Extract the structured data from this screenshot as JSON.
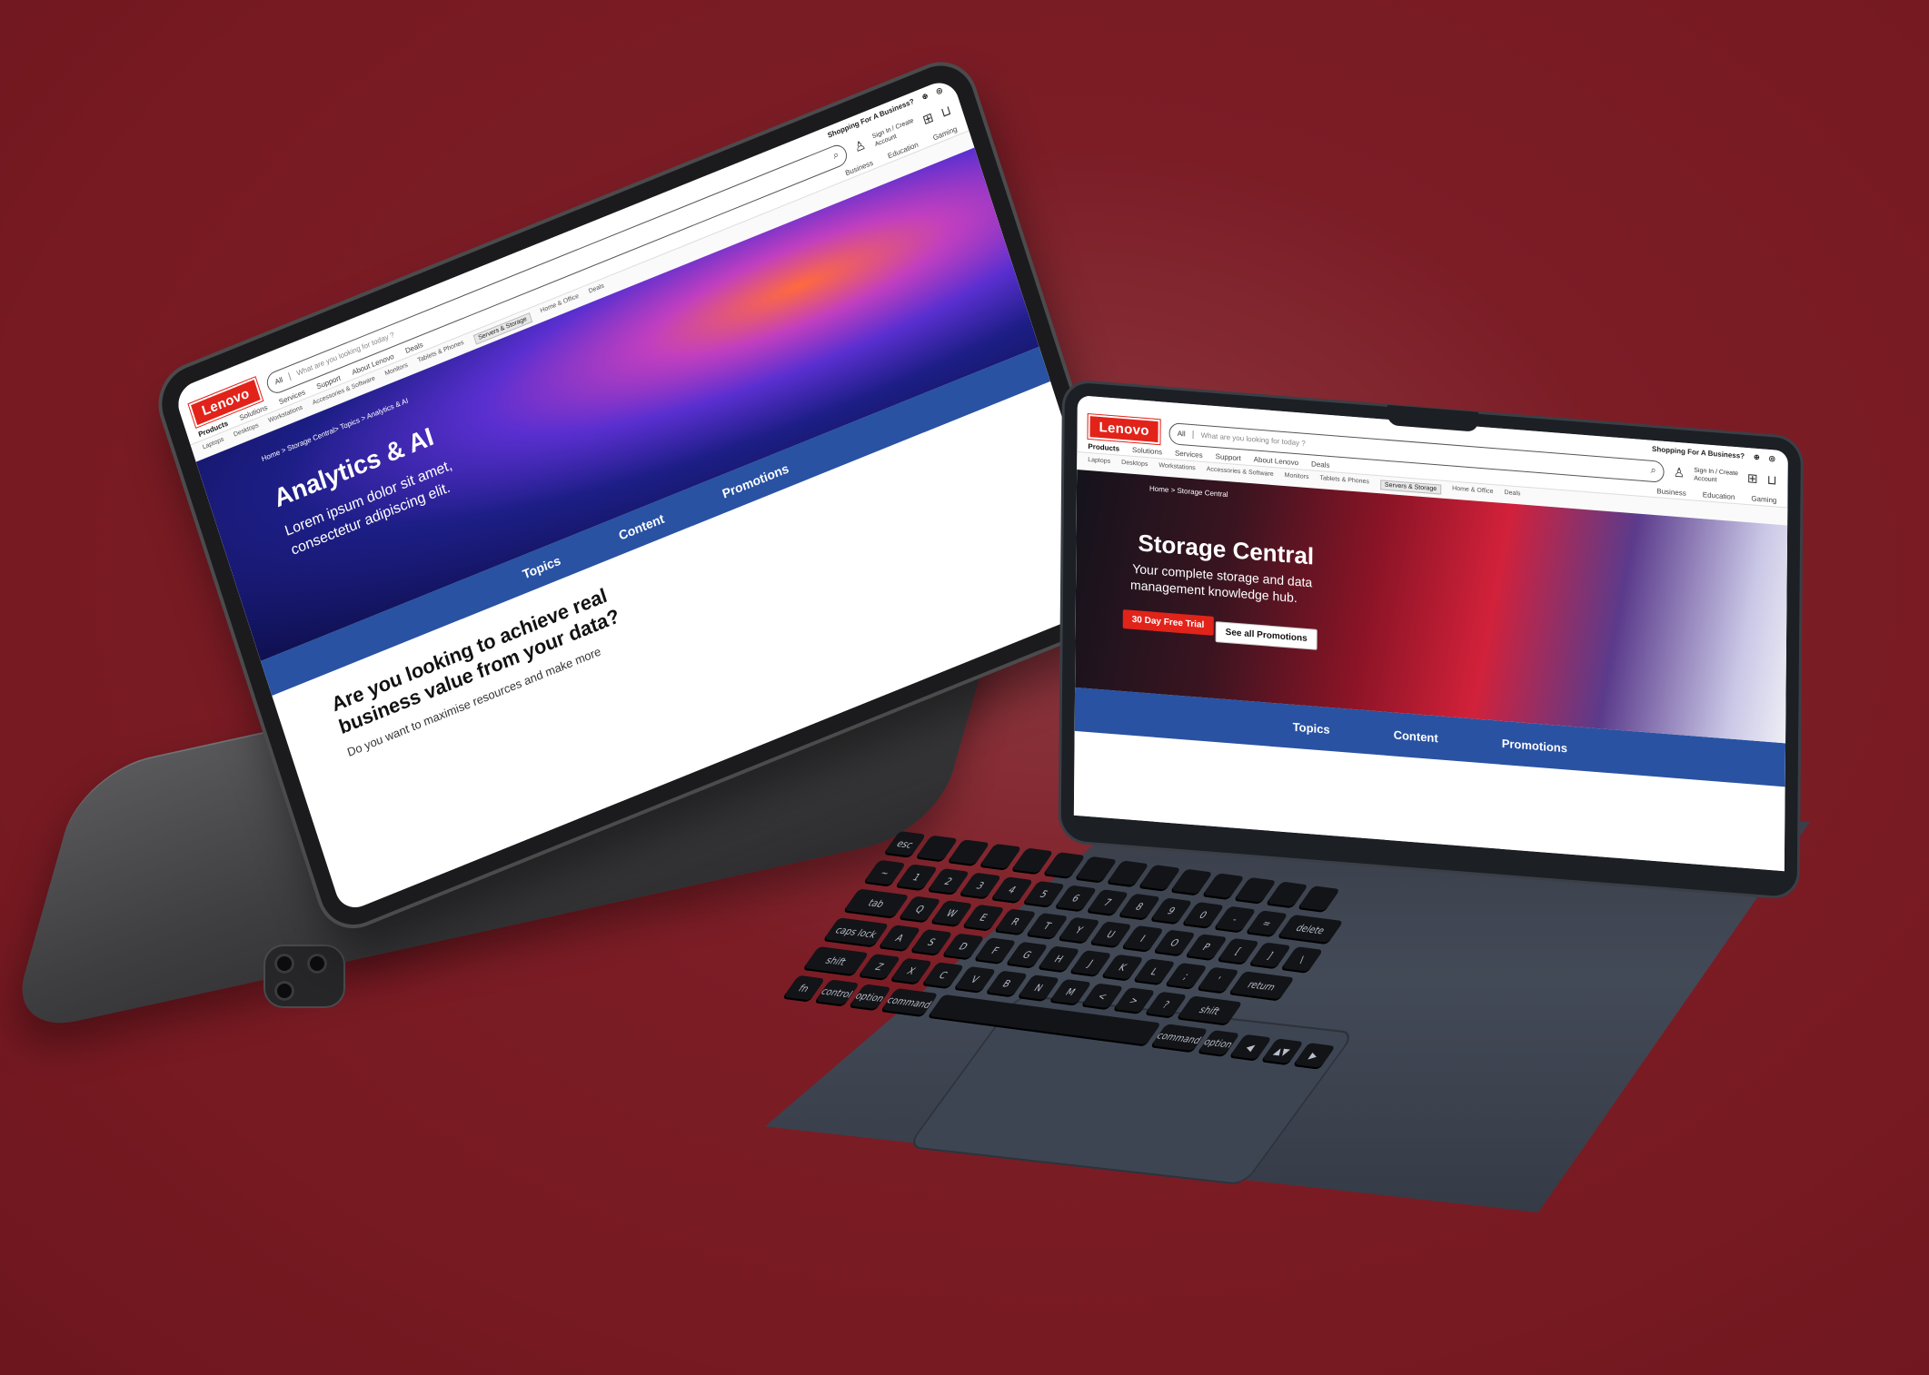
{
  "colors": {
    "background": "#7c1d26",
    "brand_red": "#e2231a",
    "tab_blue": "#2952a3"
  },
  "site": {
    "topbar": {
      "business_label": "Shopping For A Business?"
    },
    "logo": "Lenovo",
    "search": {
      "scope": "All",
      "placeholder": "What are you looking for today ?"
    },
    "account": {
      "line1": "Sign In / Create",
      "line2": "Account"
    },
    "menu": [
      "Products",
      "Solutions",
      "Services",
      "Support",
      "About Lenovo",
      "Deals"
    ],
    "segments": [
      "Business",
      "Education",
      "Gaming"
    ],
    "categories": [
      "Laptops",
      "Desktops",
      "Workstations",
      "Accessories & Software",
      "Monitors",
      "Tablets & Phones",
      "Servers & Storage",
      "Home & Office",
      "Deals"
    ],
    "tabs": [
      "Topics",
      "Content",
      "Promotions"
    ]
  },
  "laptop_page": {
    "breadcrumb": "Home > Storage Central",
    "title": "Storage Central",
    "subtitle_1": "Your complete storage and data",
    "subtitle_2": "management knowledge hub.",
    "primary_button": "30 Day Free Trial",
    "secondary_button": "See all Promotions"
  },
  "tablet_page": {
    "breadcrumb": "Home > Storage Central> Topics > Analytics & AI",
    "title": "Analytics & AI",
    "subtitle_1": "Lorem ipsum dolor sit amet,",
    "subtitle_2": "consectetur adipiscing elit.",
    "question_1": "Are you looking to achieve real",
    "question_2": "business value from your data?",
    "body": "Do you want to maximise resources and make more"
  },
  "keyboard": {
    "row1": [
      "esc",
      "",
      "",
      "",
      "",
      "",
      "",
      "",
      "",
      "",
      "",
      "",
      "",
      ""
    ],
    "row2": [
      "~",
      "1",
      "2",
      "3",
      "4",
      "5",
      "6",
      "7",
      "8",
      "9",
      "0",
      "-",
      "=",
      "delete"
    ],
    "row3": [
      "tab",
      "Q",
      "W",
      "E",
      "R",
      "T",
      "Y",
      "U",
      "I",
      "O",
      "P",
      "[",
      "]",
      "\\"
    ],
    "row4": [
      "caps lock",
      "A",
      "S",
      "D",
      "F",
      "G",
      "H",
      "J",
      "K",
      "L",
      ";",
      "'",
      "return"
    ],
    "row5": [
      "shift",
      "Z",
      "X",
      "C",
      "V",
      "B",
      "N",
      "M",
      "<",
      ">",
      "?",
      "shift"
    ],
    "row6": [
      "fn",
      "control",
      "option",
      "command",
      "",
      "command",
      "option",
      "◀",
      "▲▼",
      "▶"
    ]
  }
}
